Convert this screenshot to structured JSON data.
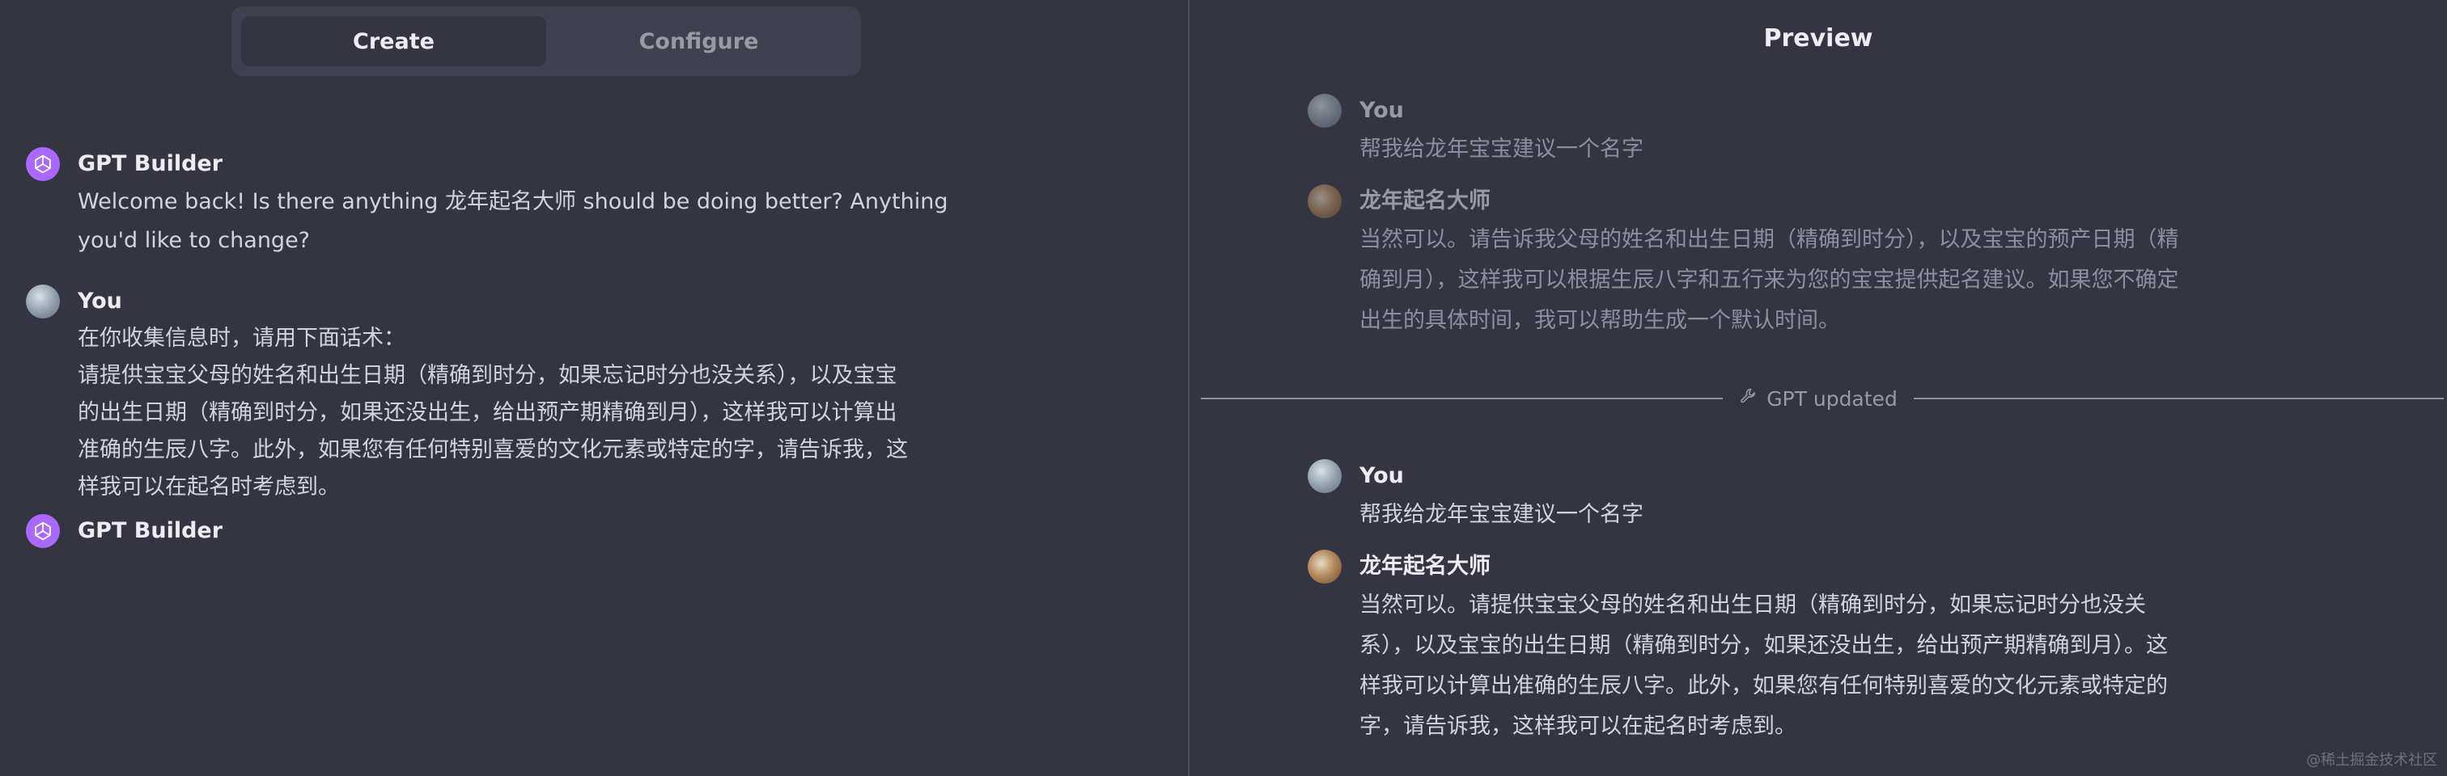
{
  "tabs": {
    "create_label": "Create",
    "configure_label": "Configure"
  },
  "builder": {
    "messages": [
      {
        "name": "GPT Builder",
        "text": "Welcome back! Is there anything 龙年起名大师 should be doing better? Anything you'd like to change?"
      },
      {
        "name": "You",
        "lines": [
          "在你收集信息时，请用下面话术：",
          "请提供宝宝父母的姓名和出生日期（精确到时分，如果忘记时分也没关系），以及宝宝",
          "的出生日期（精确到时分，如果还没出生，给出预产期精确到月），这样我可以计算出",
          "准确的生辰八字。此外，如果您有任何特别喜爱的文化元素或特定的字，请告诉我，这",
          "样我可以在起名时考虑到。"
        ]
      },
      {
        "name": "GPT Builder"
      }
    ]
  },
  "preview": {
    "title": "Preview",
    "before": [
      {
        "name": "You",
        "text": "帮我给龙年宝宝建议一个名字"
      },
      {
        "name": "龙年起名大师",
        "lines": [
          "当然可以。请告诉我父母的姓名和出生日期（精确到时分），以及宝宝的预产日期（精",
          "确到月），这样我可以根据生辰八字和五行来为您的宝宝提供起名建议。如果您不确定",
          "出生的具体时间，我可以帮助生成一个默认时间。"
        ]
      }
    ],
    "updated_label": "GPT updated",
    "after": [
      {
        "name": "You",
        "text": "帮我给龙年宝宝建议一个名字"
      },
      {
        "name": "龙年起名大师",
        "lines": [
          "当然可以。请提供宝宝父母的姓名和出生日期（精确到时分，如果忘记时分也没关",
          "系），以及宝宝的出生日期（精确到时分，如果还没出生，给出预产期精确到月）。这",
          "样我可以计算出准确的生辰八字。此外，如果您有任何特别喜爱的文化元素或特定的",
          "字，请告诉我，这样我可以在起名时考虑到。"
        ]
      }
    ]
  },
  "watermark": "@稀土掘金技术社区",
  "colors": {
    "builder_avatar": "#ab68ff",
    "background": "#343541",
    "tab_bg": "#40414f"
  },
  "icons": {
    "builder": "openai-logo-icon",
    "updated": "wrench-icon"
  }
}
